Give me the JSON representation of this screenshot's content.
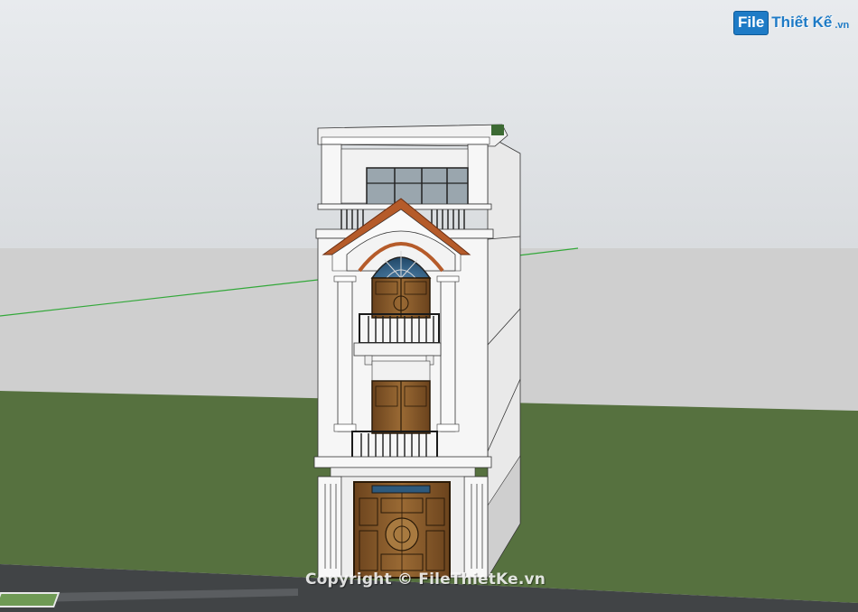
{
  "logo": {
    "badge": "File",
    "name": "Thiết Kế",
    "suffix": ".vn"
  },
  "watermark": "Copyright © FileThietKe.vn",
  "colors": {
    "sky": "#e6e9ec",
    "horizon": "#cfcfcf",
    "lawn": "#55703f",
    "road": "#3f4244",
    "wall": "#f4f4f4",
    "roof": "#b45a2a",
    "door": "#8a5a2a",
    "glass": "#2d5a7e"
  },
  "icons": [
    "green-axis-line",
    "house-model"
  ]
}
